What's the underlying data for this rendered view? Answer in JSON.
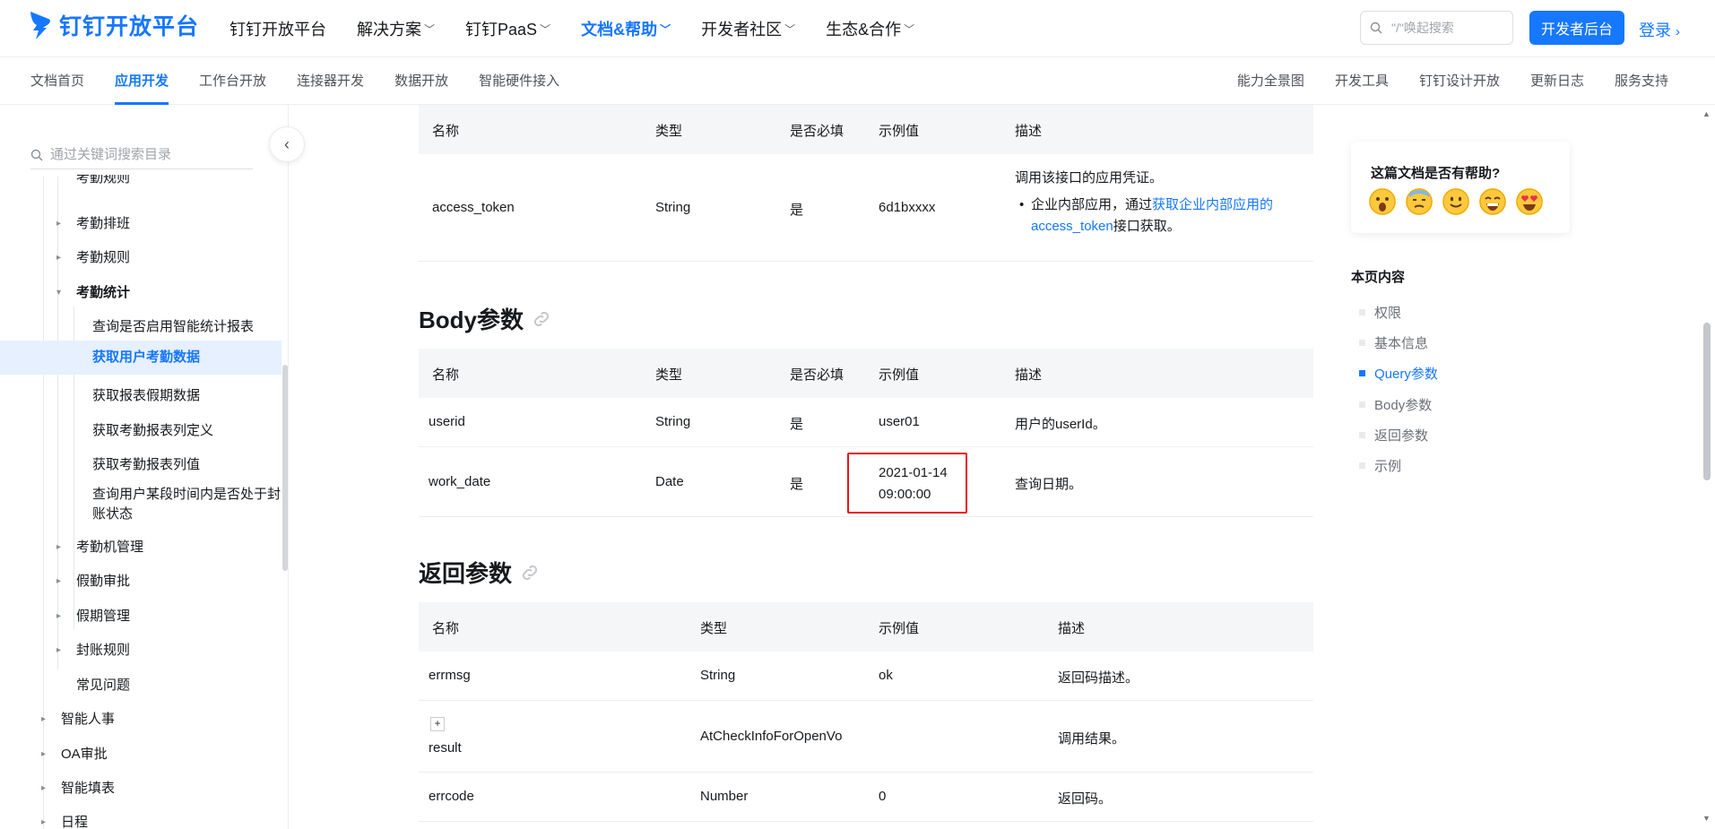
{
  "header": {
    "logo_text": "钉钉开放平台",
    "nav": [
      {
        "label": "钉钉开放平台"
      },
      {
        "label": "解决方案"
      },
      {
        "label": "钉钉PaaS"
      },
      {
        "label": "文档&帮助"
      },
      {
        "label": "开发者社区"
      },
      {
        "label": "生态&合作"
      }
    ],
    "search_placeholder": "\"/\"唤起搜索",
    "dev_button": "开发者后台",
    "login": "登录"
  },
  "subnav": {
    "left": [
      "文档首页",
      "应用开发",
      "工作台开放",
      "连接器开发",
      "数据开放",
      "智能硬件接入"
    ],
    "right": [
      "能力全景图",
      "开发工具",
      "钉钉设计开放",
      "更新日志",
      "服务支持"
    ]
  },
  "sidebar": {
    "search_placeholder": "通过关键词搜索目录",
    "items": [
      {
        "label": "考勤排班"
      },
      {
        "label": "考勤规则"
      },
      {
        "label": "考勤统计"
      },
      {
        "label": "查询是否启用智能统计报表"
      },
      {
        "label": "获取用户考勤数据"
      },
      {
        "label": "获取报表假期数据"
      },
      {
        "label": "获取考勤报表列定义"
      },
      {
        "label": "获取考勤报表列值"
      },
      {
        "label": "查询用户某段时间内是否处于封账状态"
      },
      {
        "label": "考勤机管理"
      },
      {
        "label": "假勤审批"
      },
      {
        "label": "假期管理"
      },
      {
        "label": "封账规则"
      },
      {
        "label": "常见问题"
      },
      {
        "label": "智能人事"
      },
      {
        "label": "OA审批"
      },
      {
        "label": "智能填表"
      },
      {
        "label": "日程"
      }
    ]
  },
  "query_table": {
    "headers": [
      "名称",
      "类型",
      "是否必填",
      "示例值",
      "描述"
    ],
    "row": {
      "name": "access_token",
      "type": "String",
      "required": "是",
      "example": "6d1bxxxx",
      "desc_main": "调用该接口的应用凭证。",
      "desc_bullet_prefix": "企业内部应用，通过",
      "desc_link": "获取企业内部应用的access_token",
      "desc_suffix": "接口获取。"
    }
  },
  "body_section": {
    "title": "Body参数",
    "headers": [
      "名称",
      "类型",
      "是否必填",
      "示例值",
      "描述"
    ],
    "rows": [
      {
        "name": "userid",
        "type": "String",
        "required": "是",
        "example": "user01",
        "desc": "用户的userId。"
      },
      {
        "name": "work_date",
        "type": "Date",
        "required": "是",
        "example_line1": "2021-01-14",
        "example_line2": "09:00:00",
        "desc": "查询日期。"
      }
    ]
  },
  "return_section": {
    "title": "返回参数",
    "headers": [
      "名称",
      "类型",
      "示例值",
      "描述"
    ],
    "rows": [
      {
        "name": "errmsg",
        "type": "String",
        "example": "ok",
        "desc": "返回码描述。"
      },
      {
        "expand": "+",
        "name": "result",
        "type": "AtCheckInfoForOpenVo",
        "example": "",
        "desc": "调用结果。"
      },
      {
        "name": "errcode",
        "type": "Number",
        "example": "0",
        "desc": "返回码。"
      }
    ]
  },
  "feedback": {
    "question": "这篇文档是否有帮助?"
  },
  "toc": {
    "title": "本页内容",
    "items": [
      "权限",
      "基本信息",
      "Query参数",
      "Body参数",
      "返回参数",
      "示例"
    ]
  },
  "colors": {
    "accent": "#1677ff",
    "highlight": "#e8131b"
  }
}
